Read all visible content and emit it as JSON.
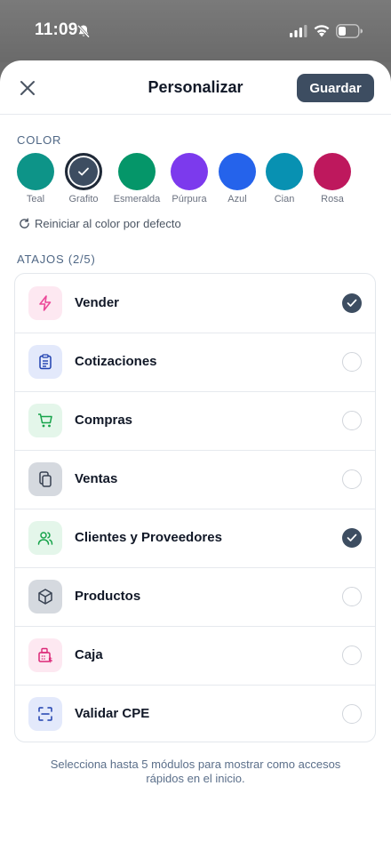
{
  "status_bar": {
    "time": "11:09"
  },
  "header": {
    "title": "Personalizar",
    "save_label": "Guardar"
  },
  "colors": {
    "section_label": "COLOR",
    "swatches": [
      {
        "name": "Teal",
        "hex": "#0d9488",
        "selected": false
      },
      {
        "name": "Grafito",
        "hex": "#3d4d61",
        "selected": true
      },
      {
        "name": "Esmeralda",
        "hex": "#059669",
        "selected": false
      },
      {
        "name": "Púrpura",
        "hex": "#7c3aed",
        "selected": false
      },
      {
        "name": "Azul",
        "hex": "#2563eb",
        "selected": false
      },
      {
        "name": "Cian",
        "hex": "#0891b2",
        "selected": false
      },
      {
        "name": "Rosa",
        "hex": "#be185d",
        "selected": false
      }
    ],
    "reset_label": "Reiniciar al color por defecto"
  },
  "shortcuts": {
    "section_label": "ATAJOS (2/5)",
    "items": [
      {
        "label": "Vender",
        "icon": "bolt-icon",
        "icon_color": "#ec4899",
        "icon_bg": "#fde8f1",
        "checked": true
      },
      {
        "label": "Cotizaciones",
        "icon": "clipboard-icon",
        "icon_color": "#1e40af",
        "icon_bg": "#e3e9fb",
        "checked": false
      },
      {
        "label": "Compras",
        "icon": "cart-icon",
        "icon_color": "#16a34a",
        "icon_bg": "#e4f6ea",
        "checked": false
      },
      {
        "label": "Ventas",
        "icon": "copy-icon",
        "icon_color": "#374151",
        "icon_bg": "#d5d9df",
        "checked": false
      },
      {
        "label": "Clientes y Proveedores",
        "icon": "users-icon",
        "icon_color": "#16a34a",
        "icon_bg": "#e4f6ea",
        "checked": true
      },
      {
        "label": "Productos",
        "icon": "box-icon",
        "icon_color": "#374151",
        "icon_bg": "#d5d9df",
        "checked": false
      },
      {
        "label": "Caja",
        "icon": "register-icon",
        "icon_color": "#db2777",
        "icon_bg": "#fde8f1",
        "checked": false
      },
      {
        "label": "Validar CPE",
        "icon": "scan-icon",
        "icon_color": "#1e40af",
        "icon_bg": "#e3e9fb",
        "checked": false
      }
    ]
  },
  "footer_note": "Selecciona hasta 5 módulos para mostrar como accesos rápidos en el inicio."
}
